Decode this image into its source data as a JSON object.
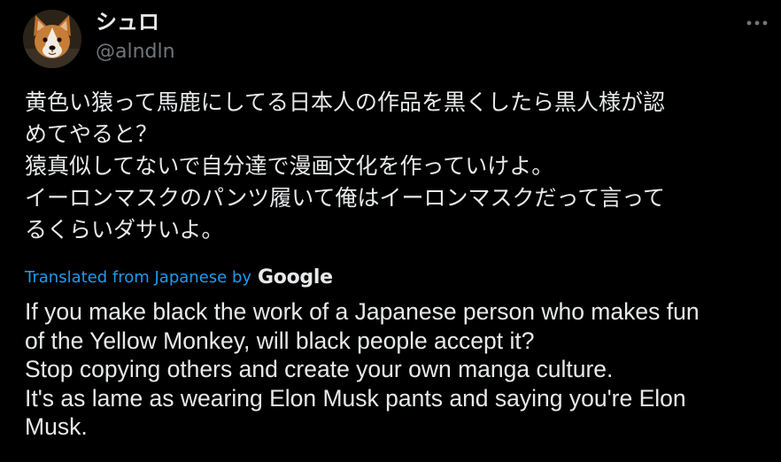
{
  "author": {
    "display_name": "シュロ",
    "handle": "@alndln",
    "avatar": "corgi-dog-photo"
  },
  "actions": {
    "more_icon": "more-horizontal-icon"
  },
  "tweet": {
    "original_lines": [
      "黄色い猿って馬鹿にしてる日本人の作品を黒くしたら黒人様が認",
      "めてやると？",
      "猿真似してないで自分達で漫画文化を作っていけよ。",
      "イーロンマスクのパンツ履いて俺はイーロンマスクだって言って",
      "るくらいダサいよ。"
    ],
    "translated_from_label": "Translated from Japanese by",
    "translator_name": "Google",
    "translated_lines": [
      "If you make black the work of a Japanese person who makes fun",
      "of the Yellow Monkey, will black people accept it?",
      "Stop copying others and create your own manga culture.",
      "It's as lame as wearing Elon Musk pants and saying you're Elon",
      "Musk."
    ]
  },
  "colors": {
    "background": "#000000",
    "primary_text": "#e7e9ea",
    "secondary_text": "#71767b",
    "link": "#1d9bf0"
  }
}
